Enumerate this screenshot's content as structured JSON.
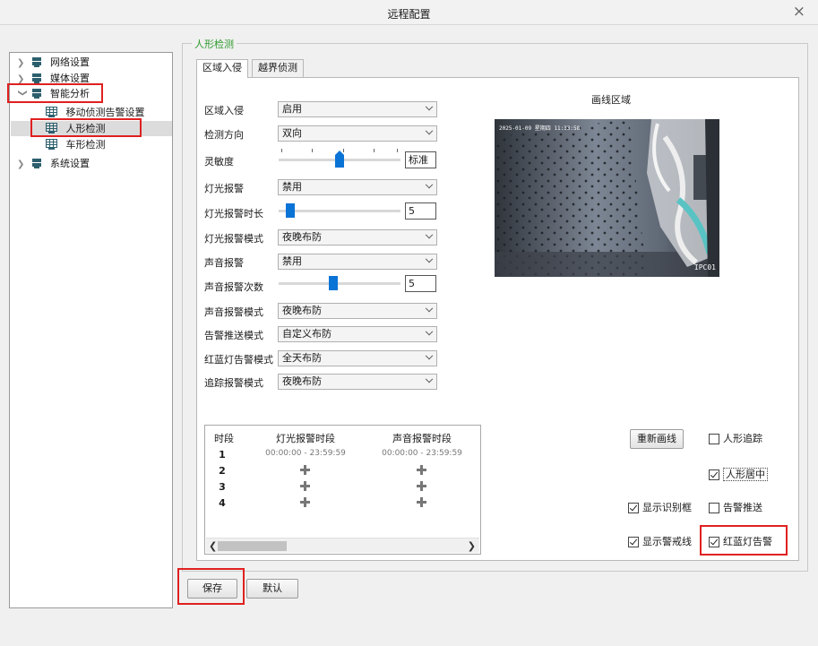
{
  "window": {
    "title": "远程配置",
    "close_symbol": "×"
  },
  "tree": {
    "items": [
      {
        "label": "网络设置",
        "expanded": false,
        "level": 0
      },
      {
        "label": "媒体设置",
        "expanded": false,
        "level": 0
      },
      {
        "label": "智能分析",
        "expanded": true,
        "level": 0
      },
      {
        "label": "移动侦测告警设置",
        "level": 1
      },
      {
        "label": "人形检测",
        "level": 1,
        "selected": true
      },
      {
        "label": "车形检测",
        "level": 1
      },
      {
        "label": "系统设置",
        "expanded": false,
        "level": 0
      }
    ]
  },
  "group": {
    "legend": "人形检测"
  },
  "tabs": [
    {
      "label": "区域入侵",
      "active": true
    },
    {
      "label": "越界侦测",
      "active": false
    }
  ],
  "form": {
    "region_intrusion": {
      "label": "区域入侵",
      "value": "启用"
    },
    "direction": {
      "label": "检测方向",
      "value": "双向"
    },
    "sensitivity": {
      "label": "灵敏度",
      "value_text": "标准",
      "level": 0.5
    },
    "light_alarm": {
      "label": "灯光报警",
      "value": "禁用"
    },
    "light_duration": {
      "label": "灯光报警时长",
      "value": "5",
      "level": 0.05
    },
    "light_mode": {
      "label": "灯光报警模式",
      "value": "夜晚布防"
    },
    "sound_alarm": {
      "label": "声音报警",
      "value": "禁用"
    },
    "sound_count": {
      "label": "声音报警次数",
      "value": "5",
      "level": 0.45
    },
    "sound_mode": {
      "label": "声音报警模式",
      "value": "夜晚布防"
    },
    "push_mode": {
      "label": "告警推送模式",
      "value": "自定义布防"
    },
    "redblue_mode": {
      "label": "红蓝灯告警模式",
      "value": "全天布防"
    },
    "track_mode": {
      "label": "追踪报警模式",
      "value": "夜晚布防"
    }
  },
  "canvas": {
    "label": "画线区域",
    "osd_time": "2025-01-09 星期四 11:33:58",
    "osd_name": "IPC01"
  },
  "schedule": {
    "headers": [
      "时段",
      "灯光报警时段",
      "声音报警时段"
    ],
    "rows": [
      {
        "index": "1",
        "light": "00:00:00 - 23:59:59",
        "sound": "00:00:00 - 23:59:59"
      },
      {
        "index": "2"
      },
      {
        "index": "3"
      },
      {
        "index": "4"
      }
    ]
  },
  "redraw_button": "重新画线",
  "checkboxes": [
    {
      "label": "人形追踪",
      "checked": false
    },
    {
      "label": "人形居中",
      "checked": true
    },
    {
      "label": "显示识别框",
      "checked": true
    },
    {
      "label": "告警推送",
      "checked": false
    },
    {
      "label": "显示警戒线",
      "checked": true
    },
    {
      "label": "红蓝灯告警",
      "checked": true
    }
  ],
  "footer": {
    "save": "保存",
    "default": "默认"
  },
  "colors": {
    "accent_green": "#2d9a2d",
    "slider_blue": "#0a73d6",
    "highlight_red": "#e02020",
    "icon_teal": "#2c5f6e"
  }
}
